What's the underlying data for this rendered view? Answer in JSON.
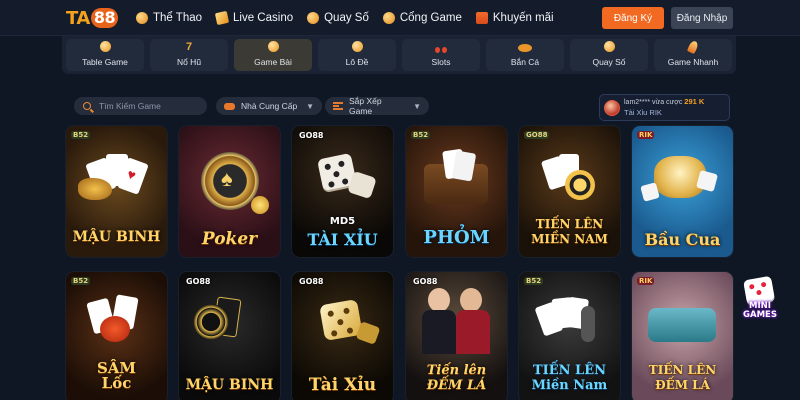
{
  "brand": {
    "logo_ta": "TA",
    "logo_88": "88"
  },
  "nav": [
    {
      "label": "Thể Thao",
      "icon": "ball-icon"
    },
    {
      "label": "Live Casino",
      "icon": "cards-icon"
    },
    {
      "label": "Quay Số",
      "icon": "lottery-icon"
    },
    {
      "label": "Cổng Game",
      "icon": "gamepad-icon"
    },
    {
      "label": "Khuyến mãi",
      "icon": "gift-icon"
    }
  ],
  "auth": {
    "register": "Đăng Ký",
    "login": "Đăng Nhập"
  },
  "categories": [
    {
      "label": "Table Game",
      "icon": "dice-icon",
      "glyph": ""
    },
    {
      "label": "Nổ Hũ",
      "icon": "number-seven-icon",
      "glyph": "7"
    },
    {
      "label": "Game Bài",
      "icon": "chips-icon",
      "glyph": "",
      "active": true
    },
    {
      "label": "Lô Đề",
      "icon": "coin-icon",
      "glyph": ""
    },
    {
      "label": "Slots",
      "icon": "cherry-icon",
      "glyph": ""
    },
    {
      "label": "Bắn Cá",
      "icon": "fish-icon",
      "glyph": ""
    },
    {
      "label": "Quay Số",
      "icon": "lottery-ball-icon",
      "glyph": ""
    },
    {
      "label": "Game Nhanh",
      "icon": "rocket-icon",
      "glyph": ""
    }
  ],
  "filters": {
    "search_placeholder": "Tìm Kiếm Game",
    "provider_label": "Nhà Cung Cấp",
    "sort_label": "Sắp Xếp Game"
  },
  "winner": {
    "user": "lam2****",
    "action": "vừa cược",
    "amount": "291 K",
    "game": "Tài Xỉu RIK"
  },
  "games": [
    {
      "title": "MẬU BINH",
      "subtitle": "",
      "brand": "B52",
      "theme": "mau-binh-b52"
    },
    {
      "title": "Poker",
      "subtitle": "",
      "brand": "",
      "theme": "poker"
    },
    {
      "title": "TÀI XỈU",
      "subtitle": "MD5",
      "brand": "GO88",
      "theme": "tai-xiu-md5"
    },
    {
      "title": "PHỎM",
      "subtitle": "",
      "brand": "B52",
      "theme": "phom"
    },
    {
      "title": "TIẾN LÊN MIỀN NAM",
      "subtitle": "",
      "brand": "GO88",
      "theme": "tien-len-go88"
    },
    {
      "title": "Bầu Cua",
      "subtitle": "",
      "brand": "RIK",
      "theme": "bau-cua"
    },
    {
      "title": "SÂM Lốc",
      "subtitle": "",
      "brand": "B52",
      "theme": "sam-loc"
    },
    {
      "title": "MẬU BINH",
      "subtitle": "",
      "brand": "GO88",
      "theme": "mau-binh-go88"
    },
    {
      "title": "Tài Xỉu",
      "subtitle": "",
      "brand": "GO88",
      "theme": "tai-xiu-go88"
    },
    {
      "title": "Tiến lên ĐẾM LÁ",
      "subtitle": "",
      "brand": "GO88",
      "theme": "tien-len-dem-la-go88"
    },
    {
      "title": "TIẾN LÊN Miền Nam",
      "subtitle": "",
      "brand": "B52",
      "theme": "tien-len-b52"
    },
    {
      "title": "TIẾN LÊN ĐẾM LÁ",
      "subtitle": "",
      "brand": "RIK",
      "theme": "tien-len-dem-la-rik"
    }
  ],
  "mini_games": {
    "label": "MINI GAMES"
  },
  "colors": {
    "background": "#0f1725",
    "accent": "#f26a22",
    "gold": "#ffd56a"
  }
}
